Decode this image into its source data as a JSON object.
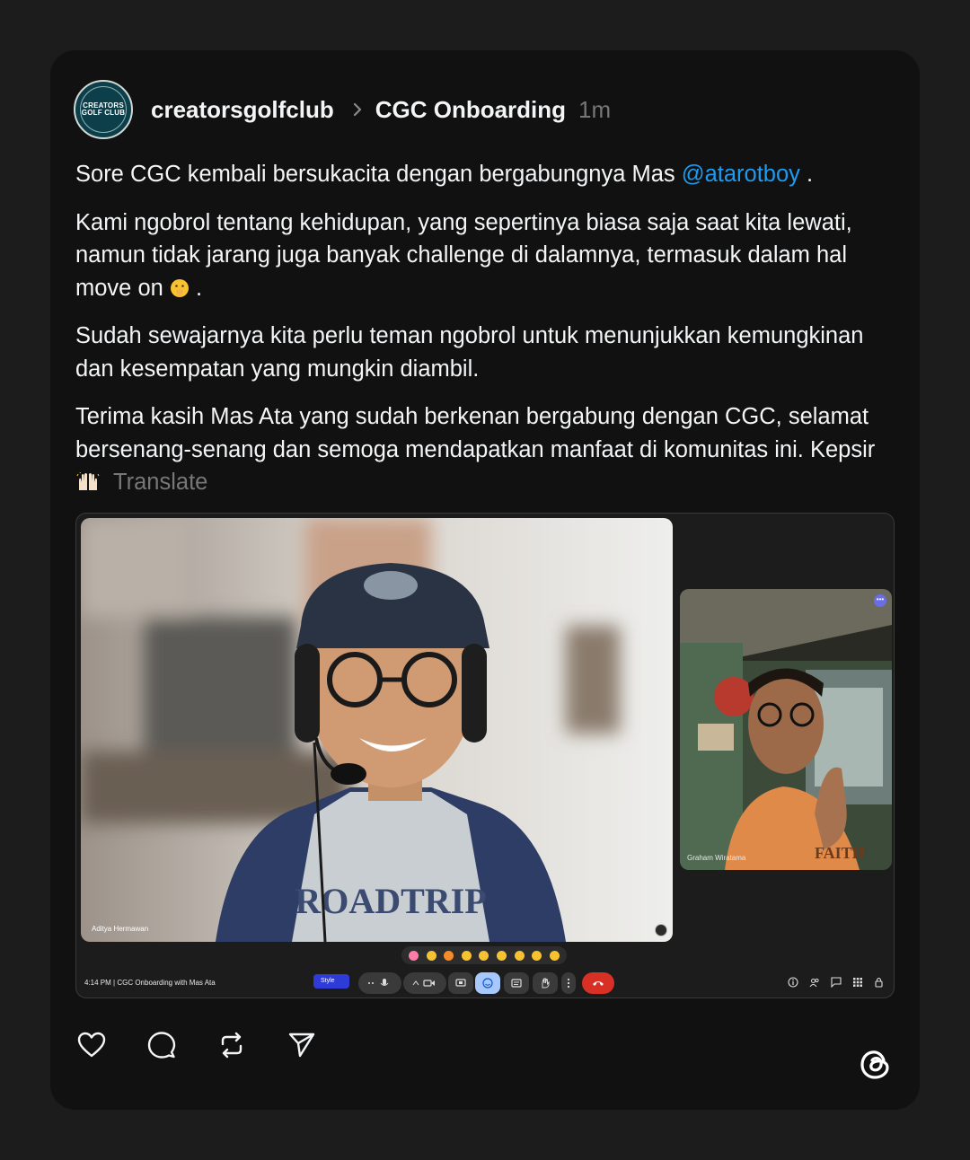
{
  "post": {
    "avatar_text_line1": "CREATORS",
    "avatar_text_line2": "GOLF CLUB",
    "author": "creatorsgolfclub",
    "community": "CGC Onboarding",
    "time": "1m",
    "paragraph1_before": "Sore CGC kembali bersukacita dengan bergabungnya Mas ",
    "mention": "@atarotboy",
    "paragraph1_after": " .",
    "paragraph2": "Kami ngobrol tentang kehidupan, yang sepertinya biasa saja saat kita lewati, namun tidak jarang juga banyak challenge di dalamnya, termasuk dalam hal move on ",
    "paragraph2_after": " .",
    "paragraph3": "Sudah sewajarnya kita perlu teman ngobrol untuk menunjukkan kemungkinan dan kesempatan yang mungkin diambil.",
    "paragraph4": "Terima kasih Mas Ata yang sudah berkenan bergabung dengan CGC, selamat bersenang-senang dan semoga mendapatkan manfaat di komunitas ini. Kepsir ",
    "translate": "Translate"
  },
  "meeting": {
    "main_participant": "Aditya Hermawan",
    "side_participant": "Graham Wiratama",
    "badge": "•••",
    "clock": "4:14 PM  |  CGC Onboarding with Mas Ata",
    "style_label": "Style"
  },
  "icons": {
    "like": "heart-icon",
    "comment": "comment-icon",
    "repost": "repost-icon",
    "share": "send-icon",
    "brand": "threads-logo"
  }
}
